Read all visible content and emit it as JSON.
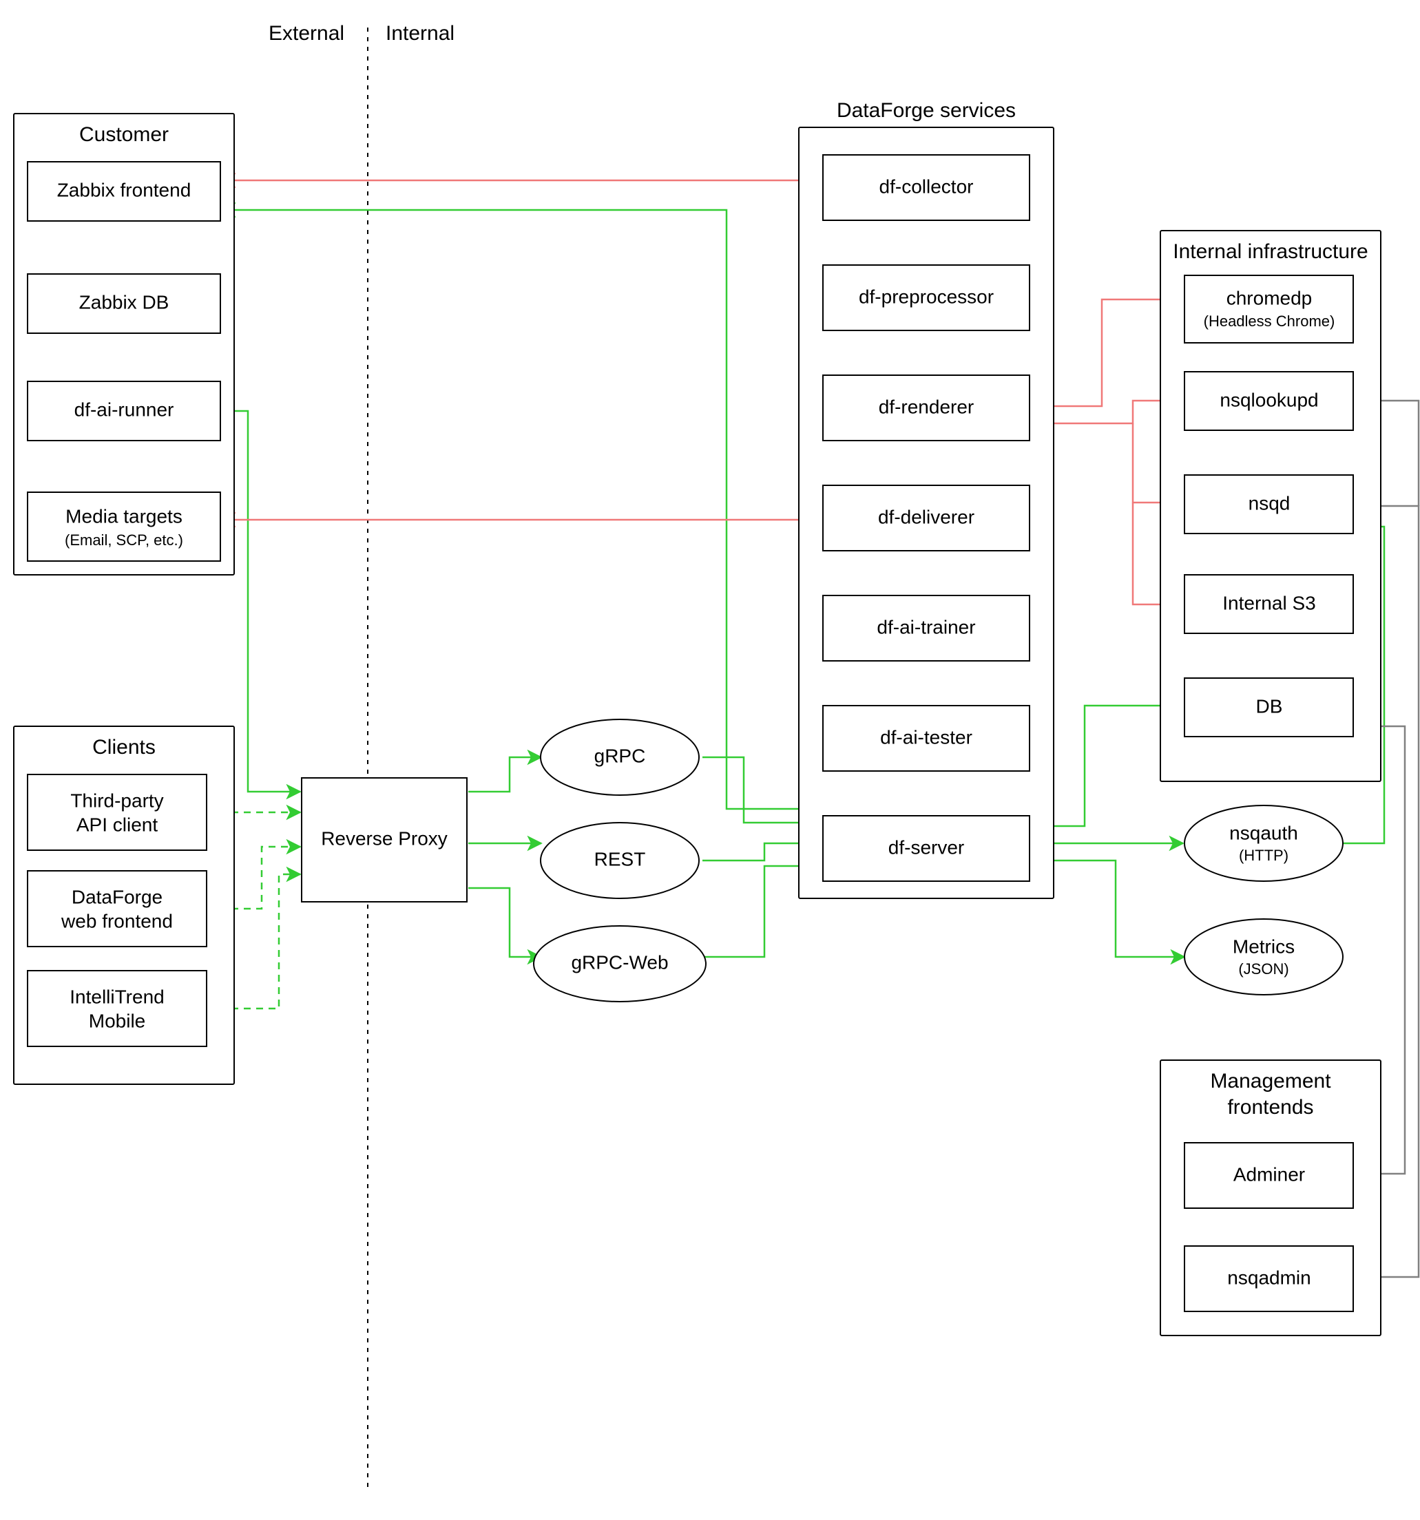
{
  "zones": {
    "external": "External",
    "internal": "Internal"
  },
  "groups": {
    "customer": {
      "title": "Customer",
      "nodes": [
        "zabbix_frontend",
        "zabbix_db",
        "df_ai_runner",
        "media_targets"
      ]
    },
    "clients": {
      "title": "Clients",
      "nodes": [
        "third_party_api",
        "df_web_frontend",
        "intellitrend_mobile"
      ]
    },
    "dataforge": {
      "title": "DataForge services",
      "nodes": [
        "df_collector",
        "df_preprocessor",
        "df_renderer",
        "df_deliverer",
        "df_ai_trainer",
        "df_ai_tester",
        "df_server"
      ]
    },
    "infra": {
      "title": "Internal infrastructure",
      "nodes": [
        "chromedp",
        "nsqlookupd",
        "nsqd",
        "internal_s3",
        "db"
      ]
    },
    "mgmt": {
      "title": "Management frontends",
      "nodes": [
        "adminer",
        "nsqadmin"
      ]
    }
  },
  "nodes": {
    "zabbix_frontend": {
      "label": "Zabbix frontend"
    },
    "zabbix_db": {
      "label": "Zabbix DB"
    },
    "df_ai_runner": {
      "label": "df-ai-runner"
    },
    "media_targets": {
      "label": "Media targets",
      "sublabel": "(Email, SCP, etc.)"
    },
    "third_party_api": {
      "label": "Third-party",
      "sublabel": "API client"
    },
    "df_web_frontend": {
      "label": "DataForge",
      "sublabel": "web frontend"
    },
    "intellitrend_mobile": {
      "label": "IntelliTrend",
      "sublabel": "Mobile"
    },
    "reverse_proxy": {
      "label": "Reverse Proxy"
    },
    "grpc": {
      "label": "gRPC"
    },
    "rest": {
      "label": "REST"
    },
    "grpc_web": {
      "label": "gRPC-Web"
    },
    "df_collector": {
      "label": "df-collector"
    },
    "df_preprocessor": {
      "label": "df-preprocessor"
    },
    "df_renderer": {
      "label": "df-renderer"
    },
    "df_deliverer": {
      "label": "df-deliverer"
    },
    "df_ai_trainer": {
      "label": "df-ai-trainer"
    },
    "df_ai_tester": {
      "label": "df-ai-tester"
    },
    "df_server": {
      "label": "df-server"
    },
    "chromedp": {
      "label": "chromedp",
      "sublabel": "(Headless Chrome)"
    },
    "nsqlookupd": {
      "label": "nsqlookupd"
    },
    "nsqd": {
      "label": "nsqd"
    },
    "internal_s3": {
      "label": "Internal S3"
    },
    "db": {
      "label": "DB"
    },
    "nsqauth": {
      "label": "nsqauth",
      "sublabel": "(HTTP)"
    },
    "metrics": {
      "label": "Metrics",
      "sublabel": "(JSON)"
    },
    "adminer": {
      "label": "Adminer"
    },
    "nsqadmin": {
      "label": "nsqadmin"
    }
  },
  "edges": [
    {
      "from": "zabbix_frontend",
      "to": "zabbix_db",
      "style": "black",
      "bidir": false
    },
    {
      "from": "df_ai_runner",
      "to": "zabbix_db",
      "style": "black",
      "bidir": false
    },
    {
      "from": "df_ai_runner",
      "to": "media_targets",
      "style": "black",
      "bidir": false
    },
    {
      "from": "third_party_api",
      "to": "reverse_proxy",
      "style": "green-dash",
      "bidir": false
    },
    {
      "from": "df_web_frontend",
      "to": "reverse_proxy",
      "style": "green-dash",
      "bidir": false
    },
    {
      "from": "intellitrend_mobile",
      "to": "reverse_proxy",
      "style": "green-dash",
      "bidir": false
    },
    {
      "from": "reverse_proxy",
      "to": "grpc",
      "style": "green",
      "bidir": false
    },
    {
      "from": "reverse_proxy",
      "to": "rest",
      "style": "green",
      "bidir": false
    },
    {
      "from": "reverse_proxy",
      "to": "grpc_web",
      "style": "green",
      "bidir": false
    },
    {
      "from": "grpc",
      "to": "df_server",
      "style": "green",
      "bidir": false
    },
    {
      "from": "rest",
      "to": "df_server",
      "style": "green",
      "bidir": false
    },
    {
      "from": "grpc_web",
      "to": "df_server",
      "style": "green",
      "bidir": false
    },
    {
      "from": "df_ai_runner",
      "to": "reverse_proxy",
      "style": "green",
      "bidir": false
    },
    {
      "from": "df_collector",
      "to": "zabbix_frontend",
      "style": "red",
      "bidir": false
    },
    {
      "from": "df_deliverer",
      "to": "media_targets",
      "style": "red",
      "bidir": false
    },
    {
      "from": "df_server",
      "to": "zabbix_frontend",
      "style": "green",
      "bidir": false
    },
    {
      "from": "df_renderer",
      "to": "chromedp",
      "style": "red",
      "bidir": true
    },
    {
      "from": "df_renderer",
      "to": "nsqlookupd",
      "style": "red",
      "bidir": false
    },
    {
      "from": "df_renderer",
      "to": "nsqd",
      "style": "red",
      "bidir": false
    },
    {
      "from": "df_renderer",
      "to": "internal_s3",
      "style": "red",
      "bidir": false
    },
    {
      "from": "df_server",
      "to": "db",
      "style": "green",
      "bidir": false
    },
    {
      "from": "df_server",
      "to": "nsqauth",
      "style": "green",
      "bidir": true
    },
    {
      "from": "df_server",
      "to": "metrics",
      "style": "green",
      "bidir": false
    },
    {
      "from": "nsqauth",
      "to": "nsqd",
      "style": "green",
      "bidir": false
    },
    {
      "from": "adminer",
      "to": "db",
      "style": "gray",
      "bidir": false
    },
    {
      "from": "nsqadmin",
      "to": "nsqlookupd",
      "style": "gray",
      "bidir": false
    },
    {
      "from": "nsqadmin",
      "to": "nsqd",
      "style": "gray",
      "bidir": false
    }
  ]
}
